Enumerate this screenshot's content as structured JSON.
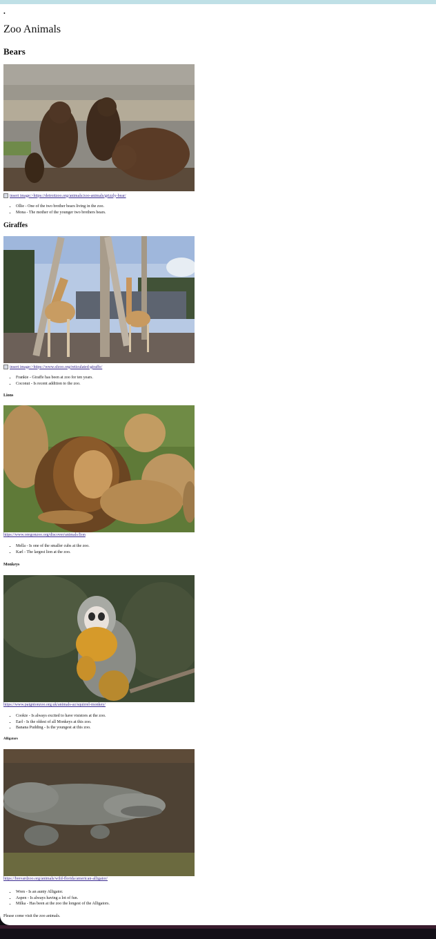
{
  "page": {
    "bullet": "•",
    "title": "Zoo Animals",
    "footer": "Please come visit the zoo animals."
  },
  "sections": {
    "bears": {
      "heading": "Bears",
      "link_text": "insert image:>https://detroitzoo.org/animals/zoo-animals/grizzly-bear/",
      "items": [
        "Ollie - One of the two brother bears living in the zoo.",
        "Mona - The mother of the younger two brothers bears."
      ]
    },
    "giraffes": {
      "heading": "Giraffes",
      "link_text": "insert image:>https://www.sfzoo.org/reticulated-giraffe/",
      "items": [
        "Frankie - Giraffe has been at zoo for ten years.",
        "Coconut - Is recent addition to the zoo."
      ]
    },
    "lions": {
      "heading": "Lions",
      "link_text": "https://www.oregonzoo.org/discover/animals/lion",
      "items": [
        "Mella - Is one of the smaller cubs at the zoo.",
        "Karl - The largest lion at the zoo."
      ]
    },
    "monkeys": {
      "heading": "Monkeys",
      "link_text": "https://www.paigntonzoo.org.uk/animals-az/squirrel-monkey/",
      "items": [
        "Cookie - Is always excited to have visistors at the zoo.",
        "Earl - Is the oldest of all Monkeys at this zoo.",
        "Banana Pudding - Is the youngest at this zoo."
      ]
    },
    "alligators": {
      "heading": "Alligators",
      "link_text": "https://brevardzoo.org/animals/wild-florida/american-alligator/",
      "items": [
        "Wren - Is an aunty Alligator.",
        "Aspen - Is always having a lot of fun.",
        "Milka - Has been at the zoo the longest of the Alligators."
      ]
    }
  }
}
